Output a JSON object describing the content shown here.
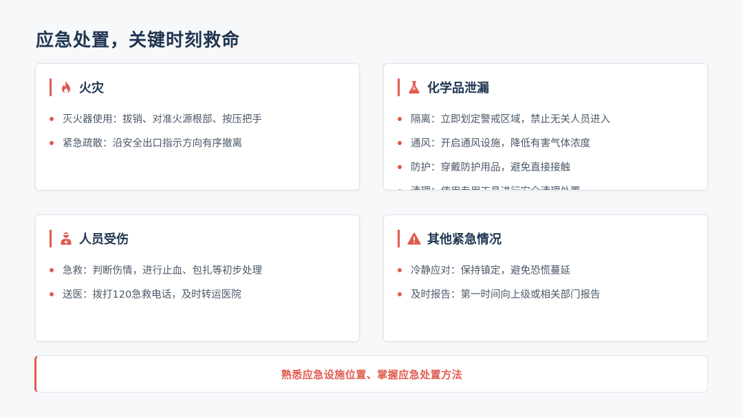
{
  "page": {
    "title": "应急处置，关键时刻救命"
  },
  "cards": [
    {
      "title": "火灾",
      "icon": "fire-icon",
      "items": [
        "灭火器使用：拔销、对准火源根部、按压把手",
        "紧急疏散：沿安全出口指示方向有序撤离"
      ]
    },
    {
      "title": "化学品泄漏",
      "icon": "flask-icon",
      "items": [
        "隔离：立即划定警戒区域，禁止无关人员进入",
        "通风：开启通风设施，降低有害气体浓度",
        "防护：穿戴防护用品，避免直接接触",
        "清理：使用专用工具进行安全清理处置"
      ]
    },
    {
      "title": "人员受伤",
      "icon": "injured-person-icon",
      "items": [
        "急救：判断伤情，进行止血、包扎等初步处理",
        "送医：拨打120急救电话，及时转运医院"
      ]
    },
    {
      "title": "其他紧急情况",
      "icon": "warning-icon",
      "items": [
        "冷静应对：保持镇定，避免恐慌蔓延",
        "及时报告：第一时间向上级或相关部门报告"
      ]
    }
  ],
  "banner": {
    "text": "熟悉应急设施位置、掌握应急处置方法"
  },
  "colors": {
    "accent": "#e05a4f",
    "title": "#1f3550",
    "body_text": "#4a5868"
  }
}
